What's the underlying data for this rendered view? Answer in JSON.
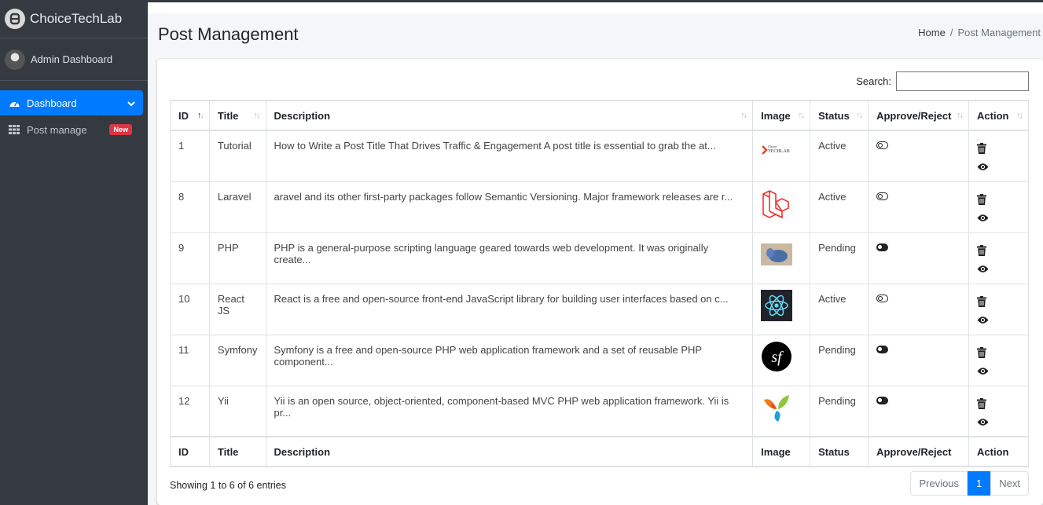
{
  "app": {
    "brand": "ChoiceTechLab"
  },
  "sidebar": {
    "user": "Admin Dashboard",
    "items": [
      {
        "label": "Dashboard",
        "icon": "tachometer-icon",
        "active": true
      },
      {
        "label": "Post manage",
        "icon": "grid-icon",
        "badge": "New"
      }
    ]
  },
  "header": {
    "title": "Post Management",
    "breadcrumb": [
      "Home",
      "/",
      "Post Management"
    ]
  },
  "search": {
    "label": "Search:",
    "value": ""
  },
  "table": {
    "columns": [
      "ID",
      "Title",
      "Description",
      "Image",
      "Status",
      "Approve/Reject",
      "Action"
    ],
    "rows": [
      {
        "id": "1",
        "title": "Tutorial",
        "description": "How to Write a Post Title That Drives Traffic & Engagement A post title is essential to grab the at...",
        "image": "choicetechlab-logo",
        "status": "Active",
        "approved": false
      },
      {
        "id": "8",
        "title": "Laravel",
        "description": "aravel and its other first-party packages follow Semantic Versioning. Major framework releases are r...",
        "image": "laravel-logo",
        "status": "Active",
        "approved": false
      },
      {
        "id": "9",
        "title": "PHP",
        "description": "PHP is a general-purpose scripting language geared towards web development. It was originally create...",
        "image": "php-elephant-photo",
        "status": "Pending",
        "approved": true
      },
      {
        "id": "10",
        "title": "React JS",
        "description": "React is a free and open-source front-end JavaScript library for building user interfaces based on c...",
        "image": "react-logo",
        "status": "Active",
        "approved": false
      },
      {
        "id": "11",
        "title": "Symfony",
        "description": "Symfony is a free and open-source PHP web application framework and a set of reusable PHP component...",
        "image": "symfony-logo",
        "status": "Pending",
        "approved": true
      },
      {
        "id": "12",
        "title": "Yii",
        "description": "Yii is an open source, object-oriented, component-based MVC PHP web application framework. Yii is pr...",
        "image": "yii-logo",
        "status": "Pending",
        "approved": true
      }
    ]
  },
  "footer": {
    "info": "Showing 1 to 6 of 6 entries",
    "pagination": {
      "previous": "Previous",
      "current": "1",
      "next": "Next"
    }
  },
  "colors": {
    "accent": "#007bff",
    "sidebar": "#343a40",
    "badge": "#dc3545"
  }
}
